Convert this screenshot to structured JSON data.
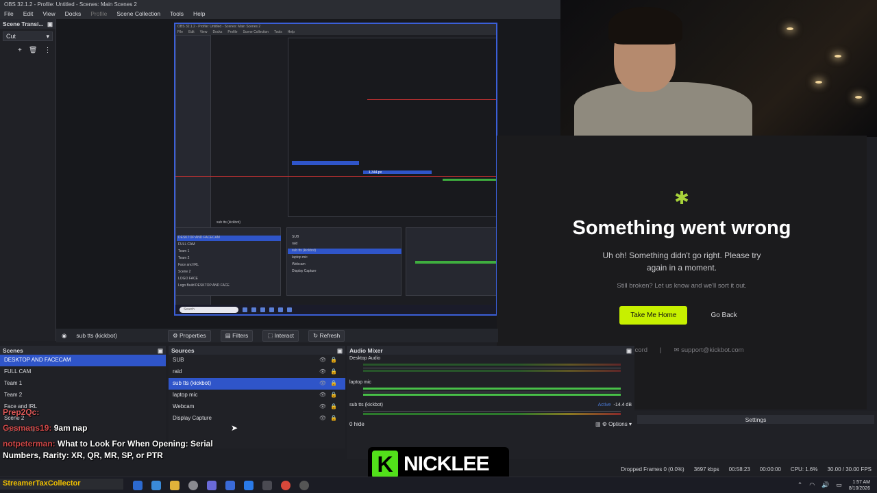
{
  "window": {
    "title": "OBS 32.1.2 - Profile: Untitled - Scenes: Main Scenes 2"
  },
  "menu": [
    "File",
    "Edit",
    "View",
    "Docks",
    "Profile",
    "Scene Collection",
    "Tools",
    "Help"
  ],
  "scene_transitions": {
    "title": "Scene Transi...",
    "value": "Cut"
  },
  "nested": {
    "title": "OBS 32.1.2 - Profile: Untitled - Scenes: Main Scenes 2",
    "px_label": "1,344 px",
    "search": "Search",
    "source_label": "sub tts (kickbot)",
    "scenes": [
      "DESKTOP AND FACECAM",
      "FULL CAM",
      "Team 1",
      "Team 2",
      "Face and IRL",
      "Scene 2",
      "LOGO FACE",
      "Logo Build DESKTOP AND FACE"
    ],
    "sources": [
      "SUB",
      "raid",
      "sub tts (kickbot)",
      "laptop mic",
      "Webcam",
      "Display Capture"
    ]
  },
  "error": {
    "title": "Something went wrong",
    "message": "Uh oh! Something didn't go right. Please try again in a moment.",
    "sub": "Still broken? Let us know and we'll sort it out.",
    "primary": "Take Me Home",
    "secondary": "Go Back",
    "discord": "Discord",
    "email": "support@kickbot.com"
  },
  "source_toolbar": {
    "selected": "sub tts (kickbot)",
    "properties": "Properties",
    "filters": "Filters",
    "interact": "Interact",
    "refresh": "Refresh"
  },
  "scenes": {
    "title": "Scenes",
    "items": [
      "DESKTOP AND FACECAM",
      "FULL CAM",
      "Team 1",
      "Team 2",
      "Face and IRL",
      "Scene 2",
      "LOGO FACE"
    ]
  },
  "sources": {
    "title": "Sources",
    "items": [
      "SUB",
      "raid",
      "sub tts (kickbot)",
      "laptop mic",
      "Webcam",
      "Display Capture"
    ]
  },
  "mixer": {
    "title": "Audio Mixer",
    "channels": [
      {
        "name": "Desktop Audio"
      },
      {
        "name": "laptop mic"
      },
      {
        "name": "sub tts (kickbot)",
        "status": "Active",
        "db": "-14.4 dB"
      }
    ]
  },
  "controls": {
    "settings": "Settings",
    "options": "Options",
    "hide": "0 hide"
  },
  "chat": [
    {
      "user": "Prep2Qc:",
      "text": ""
    },
    {
      "user": "Gesmans19:",
      "text": "9am nap"
    },
    {
      "user": "notpeterman:",
      "text": "What to Look For When Opening: Serial Numbers, Rarity: XR, QR, MR, SP, or PTR"
    }
  ],
  "nickname": {
    "letter": "K",
    "name": "NICKLEE"
  },
  "status": {
    "dropped": "Dropped Frames 0 (0.0%)",
    "kbps": "3697 kbps",
    "time1": "00:58:23",
    "time2": "00:00:00",
    "cpu": "CPU: 1.6%",
    "fps": "30.00 / 30.00 FPS"
  },
  "ticker": "StreamerTaxCollector",
  "clock": {
    "time": "1:57 AM",
    "date": "8/10/2026"
  }
}
